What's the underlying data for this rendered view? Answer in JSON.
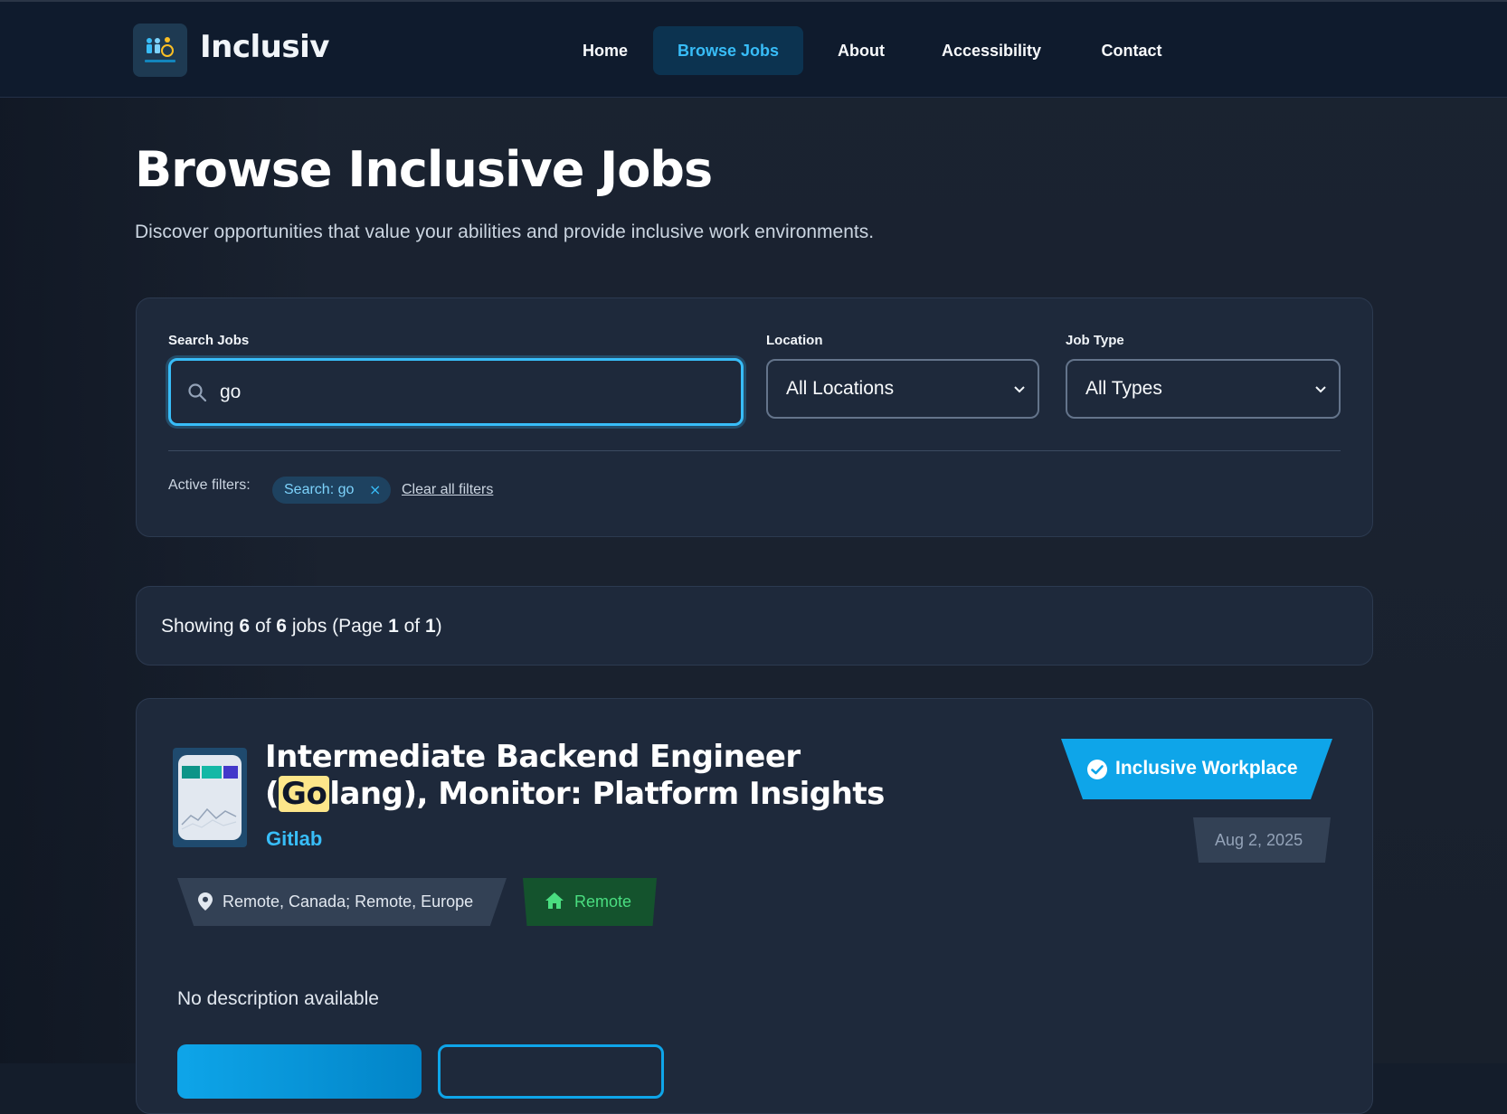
{
  "header": {
    "brand": "Inclusiv",
    "logo_icon": "accessibility-people-icon",
    "nav": [
      {
        "label": "Home",
        "active": false
      },
      {
        "label": "Browse Jobs",
        "active": true
      },
      {
        "label": "About",
        "active": false
      },
      {
        "label": "Accessibility",
        "active": false
      },
      {
        "label": "Contact",
        "active": false
      }
    ]
  },
  "page": {
    "title": "Browse Inclusive Jobs",
    "subtitle": "Discover opportunities that value your abilities and provide inclusive work environments."
  },
  "filters": {
    "search_label": "Search Jobs",
    "search_value": "go",
    "location_label": "Location",
    "location_value": "All Locations",
    "type_label": "Job Type",
    "type_value": "All Types",
    "active_label": "Active filters:",
    "chip_text": "Search: go",
    "chip_remove": "×",
    "clear_all": "Clear all filters"
  },
  "results": {
    "prefix": "Showing",
    "shown": "6",
    "of": "of",
    "total": "6",
    "jobs_page": "jobs (Page",
    "page": "1",
    "of2": "of",
    "pages": "1",
    "suffix": ")"
  },
  "job": {
    "title_before": "Intermediate Backend Engineer (",
    "title_highlight": "Go",
    "title_after": "lang), Monitor: Platform Insights",
    "company": "Gitlab",
    "badge": "Inclusive Workplace",
    "date": "Aug 2, 2025",
    "location": "Remote, Canada; Remote, Europe",
    "work_mode": "Remote",
    "description": "No description available"
  },
  "colors": {
    "accent": "#38bdf8",
    "brand_bg": "#0f1b2d",
    "highlight": "#fde68a",
    "remote_green": "#4ade80"
  }
}
